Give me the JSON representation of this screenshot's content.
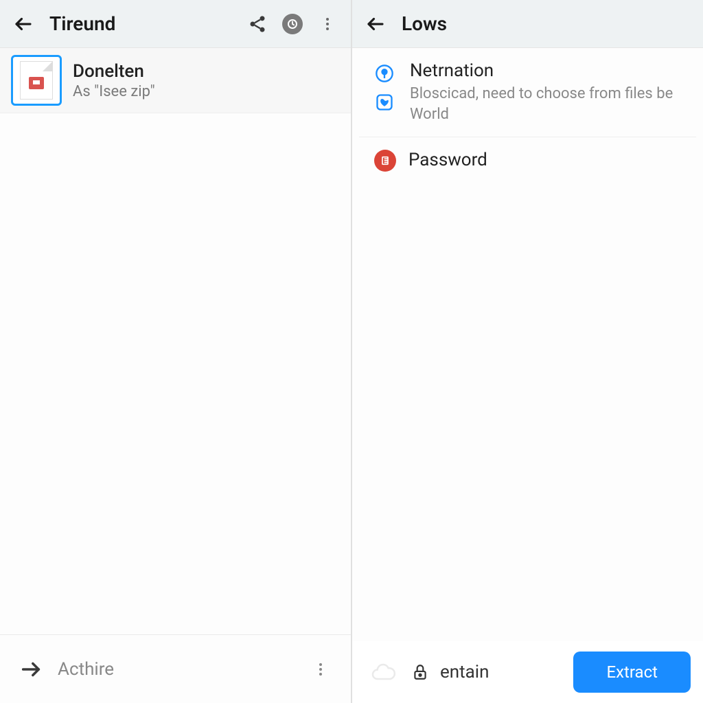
{
  "left": {
    "title": "Tireund",
    "file": {
      "name": "Donelten",
      "sub": "As \"Isee zip\""
    },
    "bottom": {
      "label": "Acthire"
    }
  },
  "right": {
    "title": "Lows",
    "option1": {
      "title": "Netrnation",
      "sub": "Bloscicad, need to choose from files be World"
    },
    "option2": {
      "title": "Password"
    },
    "bottom": {
      "label": "entain",
      "button": "Extract"
    }
  }
}
